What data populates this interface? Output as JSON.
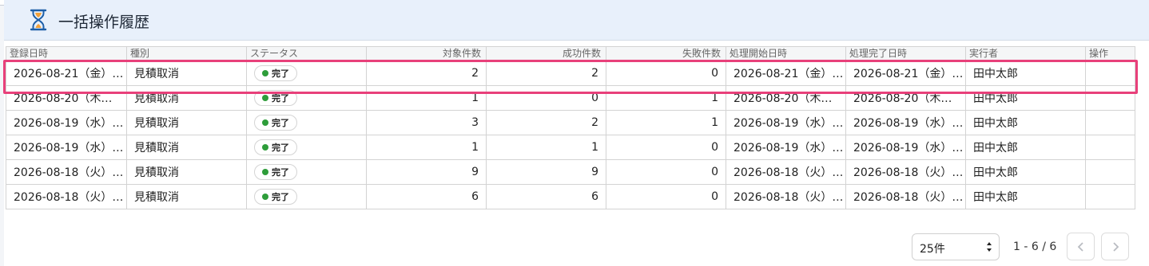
{
  "header": {
    "title": "一括操作履歴",
    "icon": "hourglass-icon"
  },
  "table": {
    "columns": [
      "登録日時",
      "種別",
      "ステータス",
      "対象件数",
      "成功件数",
      "失敗件数",
      "処理開始日時",
      "処理完了日時",
      "実行者",
      "操作"
    ],
    "rows": [
      {
        "registered": "2026-08-21（金）…",
        "type": "見積取消",
        "status": "完了",
        "target": "2",
        "success": "2",
        "failed": "0",
        "start": "2026-08-21（金）…",
        "end": "2026-08-21（金）…",
        "user": "田中太郎"
      },
      {
        "registered": "2026-08-20（木…",
        "type": "見積取消",
        "status": "完了",
        "target": "1",
        "success": "0",
        "failed": "1",
        "start": "2026-08-20（木…",
        "end": "2026-08-20（木…",
        "user": "田中太郎"
      },
      {
        "registered": "2026-08-19（水）…",
        "type": "見積取消",
        "status": "完了",
        "target": "3",
        "success": "2",
        "failed": "1",
        "start": "2026-08-19（水）…",
        "end": "2026-08-19（水）…",
        "user": "田中太郎"
      },
      {
        "registered": "2026-08-19（水）…",
        "type": "見積取消",
        "status": "完了",
        "target": "1",
        "success": "1",
        "failed": "0",
        "start": "2026-08-19（水）…",
        "end": "2026-08-19（水）…",
        "user": "田中太郎"
      },
      {
        "registered": "2026-08-18（火）…",
        "type": "見積取消",
        "status": "完了",
        "target": "9",
        "success": "9",
        "failed": "0",
        "start": "2026-08-18（火）…",
        "end": "2026-08-18（火）…",
        "user": "田中太郎"
      },
      {
        "registered": "2026-08-18（火）…",
        "type": "見積取消",
        "status": "完了",
        "target": "6",
        "success": "6",
        "failed": "0",
        "start": "2026-08-18（火）…",
        "end": "2026-08-18（火）…",
        "user": "田中太郎"
      }
    ]
  },
  "pagination": {
    "per_page": "25件",
    "range": "1 - 6 / 6"
  },
  "colors": {
    "accent": "#1e5fa8",
    "highlight": "#e8407a",
    "status_done": "#2e9d3a",
    "header_bg": "#e8f0fb"
  }
}
